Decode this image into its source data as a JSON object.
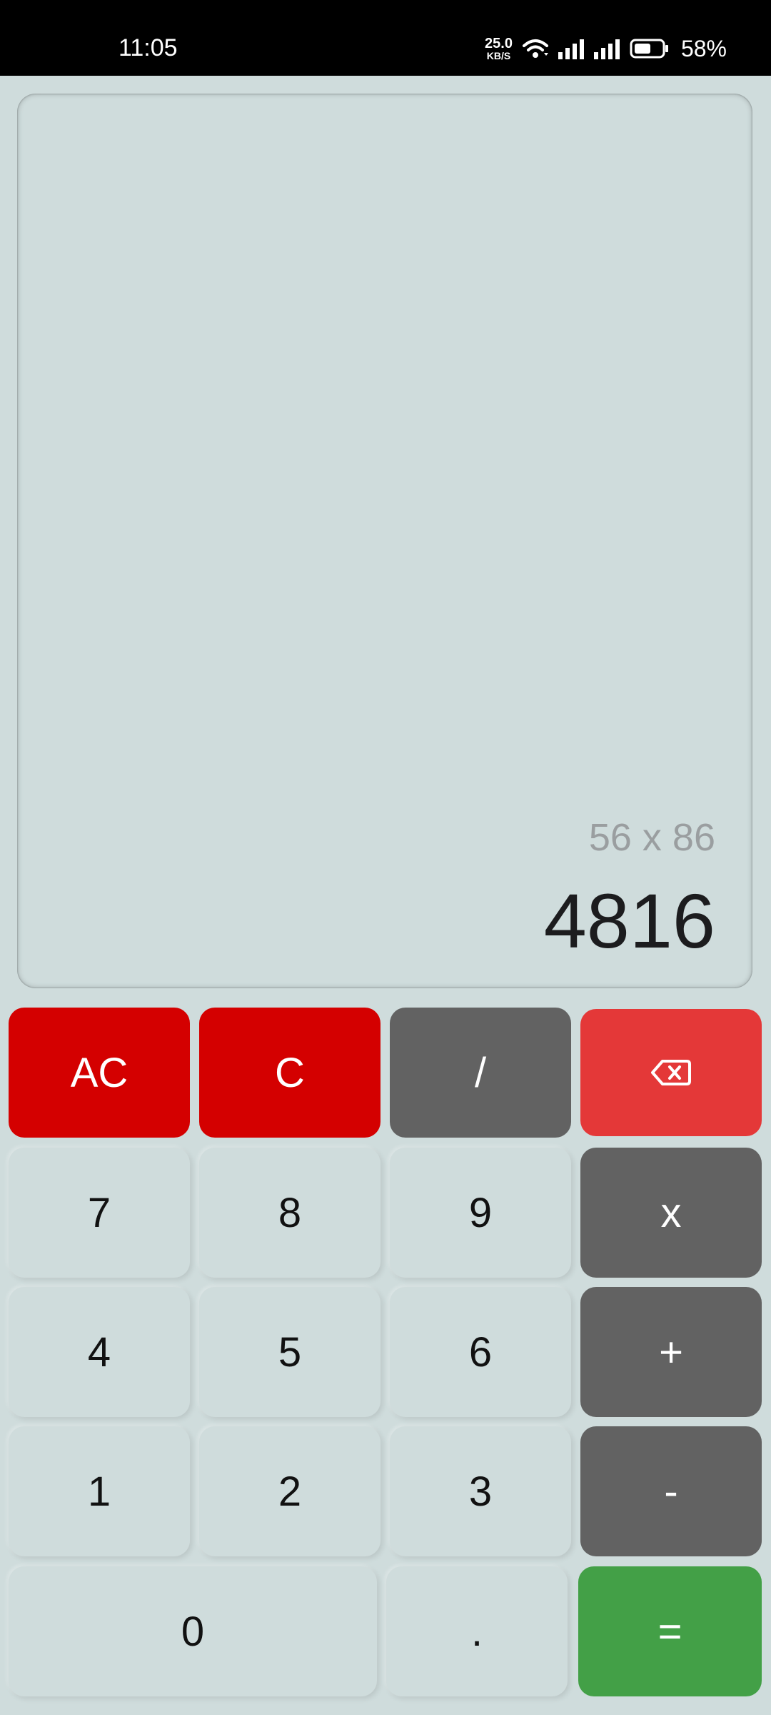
{
  "status_bar": {
    "time": "11:05",
    "net_speed_value": "25.0",
    "net_speed_unit": "KB/S",
    "battery_percent": "58%",
    "icons": [
      "wifi-icon",
      "signal-icon",
      "signal-icon",
      "battery-icon"
    ]
  },
  "display": {
    "expression": "56 x 86",
    "result": "4816"
  },
  "keys": {
    "ac": "AC",
    "c": "C",
    "divide": "/",
    "backspace_icon": "backspace-icon",
    "seven": "7",
    "eight": "8",
    "nine": "9",
    "multiply": "x",
    "four": "4",
    "five": "5",
    "six": "6",
    "plus": "+",
    "one": "1",
    "two": "2",
    "three": "3",
    "minus": "-",
    "zero": "0",
    "dot": ".",
    "equals": "="
  },
  "colors": {
    "background": "#cfdcdc",
    "clear_red": "#d40000",
    "operator_grey": "#626262",
    "backspace_red": "#e43838",
    "equals_green": "#43a047"
  }
}
